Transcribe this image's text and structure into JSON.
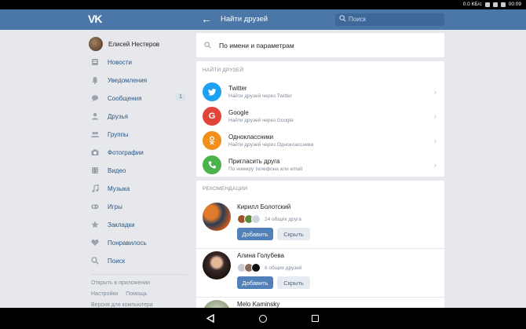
{
  "status": {
    "speed": "0.0 КБ/с",
    "time": "00:09"
  },
  "header": {
    "logo": "VK",
    "back": "←",
    "title": "Найти друзей",
    "search_placeholder": "Поиск"
  },
  "sidebar": {
    "user_name": "Елисей Нестеров",
    "items": [
      {
        "label": "Новости",
        "icon": "news-icon"
      },
      {
        "label": "Уведомления",
        "icon": "bell-icon"
      },
      {
        "label": "Сообщения",
        "icon": "message-icon",
        "badge": "1"
      },
      {
        "label": "Друзья",
        "icon": "user-icon"
      },
      {
        "label": "Группы",
        "icon": "users-icon"
      },
      {
        "label": "Фотографии",
        "icon": "camera-icon"
      },
      {
        "label": "Видео",
        "icon": "video-icon"
      },
      {
        "label": "Музыка",
        "icon": "music-icon"
      },
      {
        "label": "Игры",
        "icon": "gamepad-icon"
      },
      {
        "label": "Закладки",
        "icon": "star-icon"
      },
      {
        "label": "Понравилось",
        "icon": "heart-icon"
      },
      {
        "label": "Поиск",
        "icon": "search-icon"
      }
    ],
    "footer": {
      "open_in_app": "Открыть в приложении",
      "settings": "Настройки",
      "help": "Помощь",
      "desktop": "Версия для компьютера"
    }
  },
  "main": {
    "search_placeholder": "По имени и параметрам",
    "find_title": "НАЙТИ ДРУЗЕЙ",
    "services": [
      {
        "name": "Twitter",
        "desc": "Найти друзей через Twitter",
        "color": "#1da1f2",
        "glyph": "t"
      },
      {
        "name": "Google",
        "desc": "Найти друзей через Google",
        "color": "#e0453a",
        "glyph": "G"
      },
      {
        "name": "Одноклассники",
        "desc": "Найти друзей через Одноклассники",
        "color": "#f28e1c",
        "glyph": "ok"
      },
      {
        "name": "Пригласить друга",
        "desc": "По номеру телефона или email",
        "color": "#4bb34b",
        "glyph": "✆"
      }
    ],
    "rec_title": "РЕКОМЕНДАЦИИ",
    "recommendations": [
      {
        "name": "Кирилл Болотский",
        "mutual": "24 общих друга",
        "add": "Добавить",
        "hide": "Скрыть"
      },
      {
        "name": "Алина Голубева",
        "mutual": "6 общих друзей",
        "add": "Добавить",
        "hide": "Скрыть"
      },
      {
        "name": "Melo Kaminsky"
      }
    ]
  }
}
